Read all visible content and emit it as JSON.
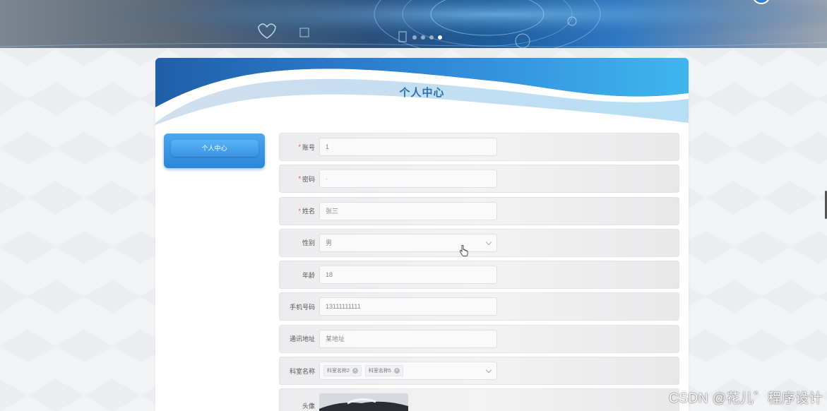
{
  "page": {
    "title": "个人中心"
  },
  "sidebar": {
    "items": [
      {
        "label": "个人中心"
      }
    ]
  },
  "form": {
    "account": {
      "label": "账号",
      "required": true,
      "value": "1"
    },
    "password": {
      "label": "密码",
      "required": true,
      "value": "·"
    },
    "name": {
      "label": "姓名",
      "required": true,
      "value": "张三"
    },
    "gender": {
      "label": "性别",
      "required": false,
      "value": "男"
    },
    "age": {
      "label": "年龄",
      "required": false,
      "value": "18"
    },
    "phone": {
      "label": "手机号码",
      "required": false,
      "value": "13111111111"
    },
    "address": {
      "label": "通讯地址",
      "required": false,
      "value": "某地址"
    },
    "department": {
      "label": "科室名称",
      "required": false,
      "tags": [
        "科室名称2",
        "科室名称5"
      ]
    },
    "avatar": {
      "label": "头像",
      "required": false
    }
  },
  "watermark": {
    "text": "CSDN @花儿゛程序设计"
  },
  "colors": {
    "accent": "#2a86d8",
    "title": "#2c6fa8",
    "required": "#e24b4b"
  }
}
